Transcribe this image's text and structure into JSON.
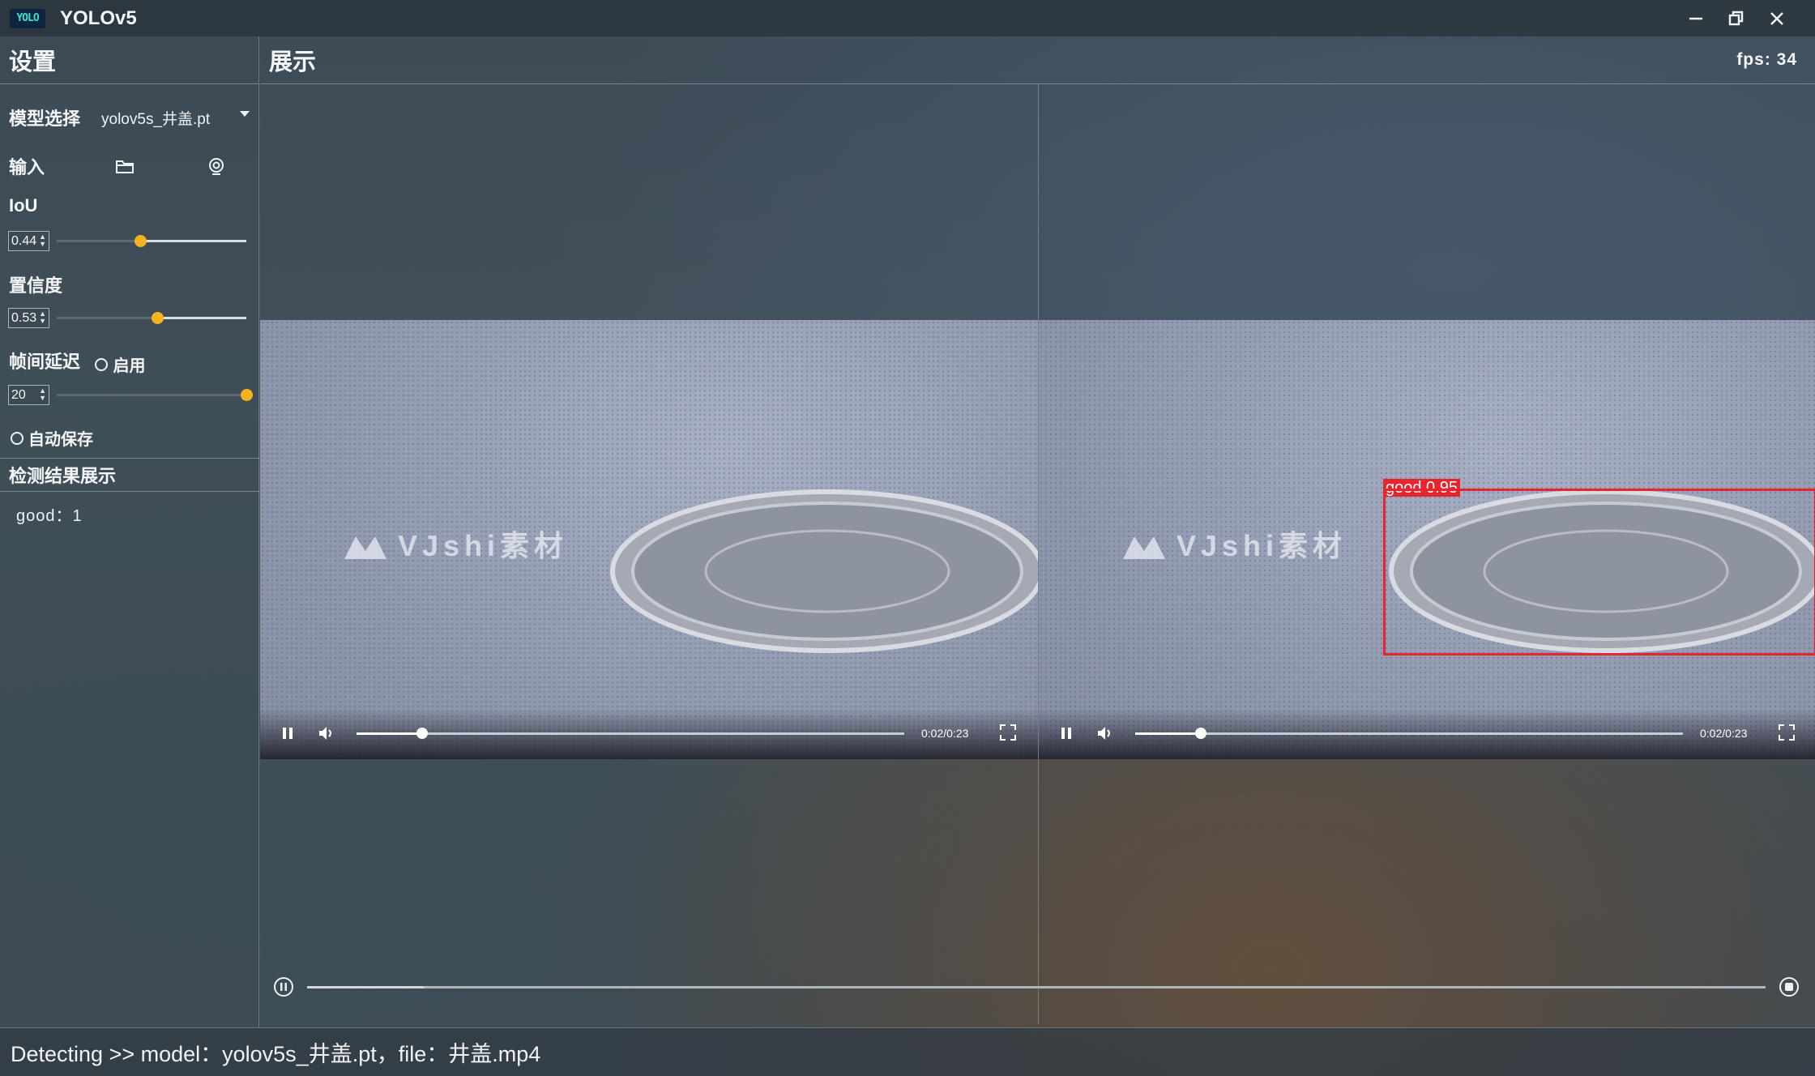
{
  "window": {
    "logo_text": "YOLO",
    "title": "YOLOv5"
  },
  "sidebar": {
    "title": "设置",
    "model": {
      "label": "模型选择",
      "value": "yolov5s_井盖.pt"
    },
    "input": {
      "label": "输入",
      "folder_icon": "folder-icon",
      "camera_icon": "webcam-icon"
    },
    "iou": {
      "label": "IoU",
      "value": "0.44",
      "level": 0.44
    },
    "confidence": {
      "label": "置信度",
      "value": "0.53",
      "level": 0.53
    },
    "frame_delay": {
      "label": "帧间延迟",
      "toggle_label": "启用",
      "value": "20",
      "level": 1.0
    },
    "autosave": {
      "label": "自动保存"
    },
    "results": {
      "title": "检测结果展示",
      "items": [
        "good：1"
      ]
    }
  },
  "main": {
    "title": "展示",
    "fps": "fps: 34",
    "videos": [
      {
        "watermark": "VJshi素材",
        "time": "0:02/0:23",
        "progress": 0.12
      },
      {
        "watermark": "VJshi素材",
        "time": "0:02/0:23",
        "progress": 0.12,
        "detection": {
          "label": "good  0.95",
          "color": "#e8252d"
        }
      }
    ],
    "playback_progress": 0.08
  },
  "statusbar": {
    "text": "Detecting >> model：yolov5s_井盖.pt，file：井盖.mp4"
  },
  "colors": {
    "accent": "#f5b320",
    "detection": "#e8252d"
  }
}
